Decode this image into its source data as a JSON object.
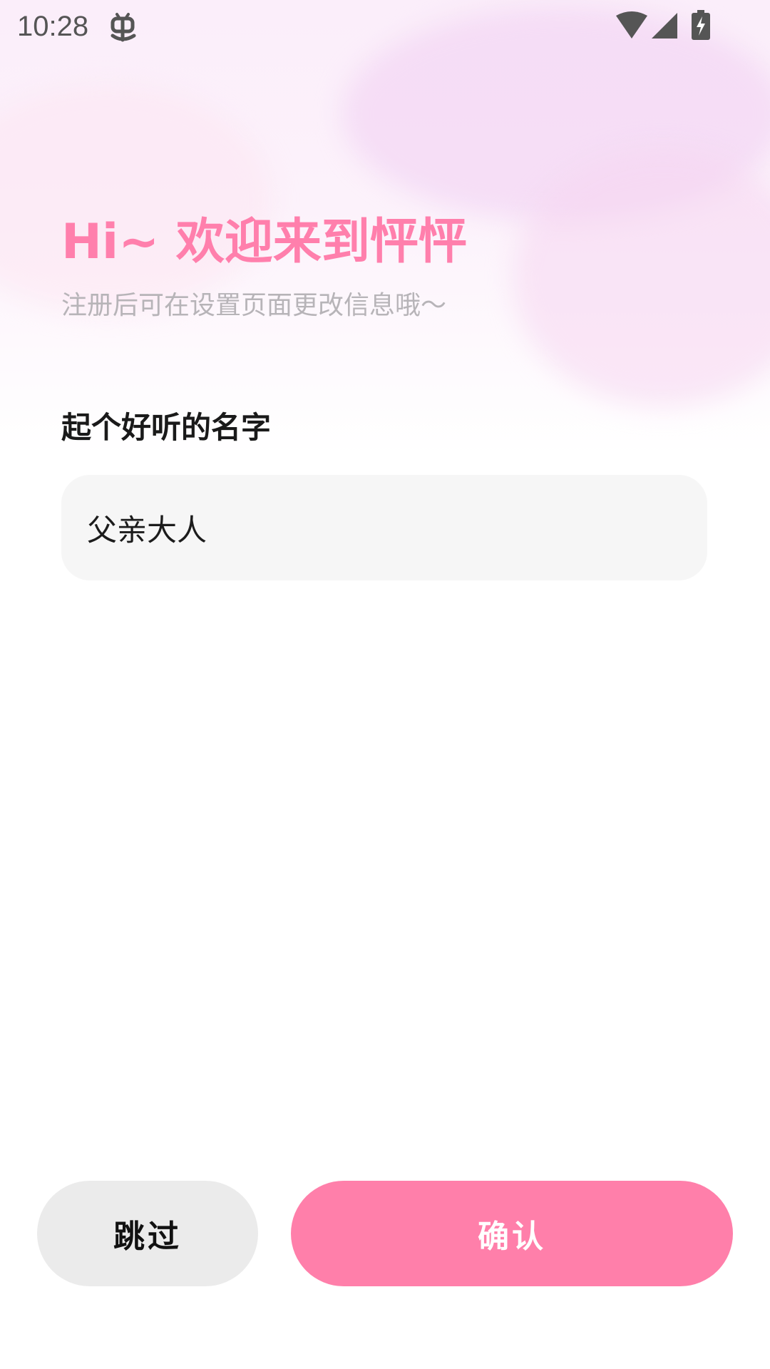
{
  "status_bar": {
    "time": "10:28",
    "app_icon": "bug-icon",
    "icons": [
      "wifi-icon",
      "signal-icon",
      "battery-charging-icon"
    ]
  },
  "header": {
    "title": "Hi~ 欢迎来到怦怦",
    "subtitle": "注册后可在设置页面更改信息哦～"
  },
  "form": {
    "name_label": "起个好听的名字",
    "name_value": "父亲大人"
  },
  "actions": {
    "skip_label": "跳过",
    "confirm_label": "确认"
  },
  "colors": {
    "accent": "#ff7faa",
    "title": "#ff7fac",
    "subtitle": "#b7b4b8",
    "input_bg": "#f6f6f6",
    "skip_bg": "#ebebeb"
  }
}
